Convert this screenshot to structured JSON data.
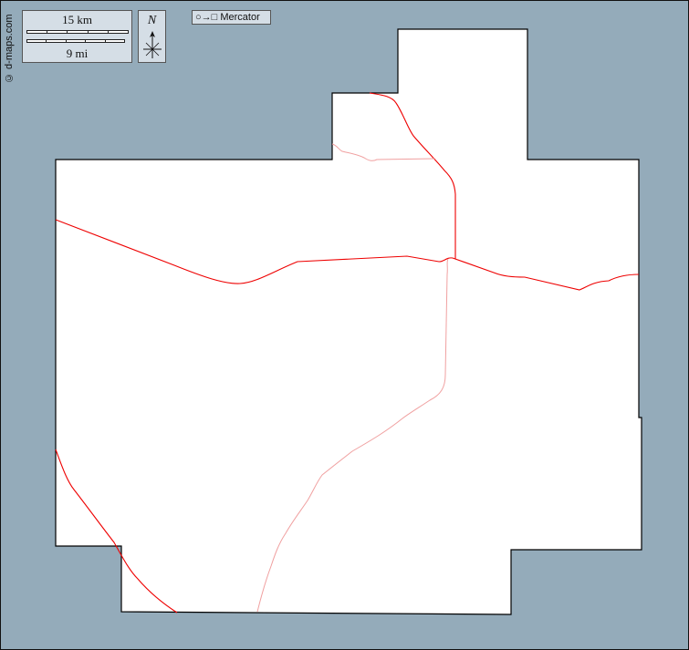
{
  "credit": "© d-maps.com",
  "scale": {
    "km_label": "15 km",
    "mi_label": "9 mi"
  },
  "north": {
    "letter": "N",
    "icon": "compass-north-arrow-icon"
  },
  "projection": {
    "icon": "circle-to-square-icon",
    "glyph": "○→□",
    "label": "Mercator"
  },
  "colors": {
    "background_sea": "#94abba",
    "land": "#ffffff",
    "border": "#000000",
    "major_road": "#ee0000",
    "minor_road": "#f0a0a0",
    "legend_box": "#d5dee6"
  },
  "layers": {
    "region_shape": "county-outline",
    "roads": [
      "major-road",
      "minor-road"
    ]
  }
}
